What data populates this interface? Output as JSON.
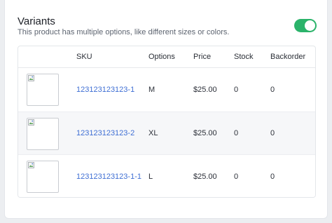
{
  "header": {
    "title": "Variants",
    "subtitle": "This product has multiple options, like different sizes or colors.",
    "toggle_on": true,
    "toggle_color": "#2bb36a"
  },
  "table": {
    "columns": [
      "",
      "SKU",
      "Options",
      "Price",
      "Stock",
      "Backorder"
    ],
    "rows": [
      {
        "sku": "123123123123-1",
        "option": "M",
        "price": "$25.00",
        "stock": "0",
        "backorder": "0"
      },
      {
        "sku": "123123123123-2",
        "option": "XL",
        "price": "$25.00",
        "stock": "0",
        "backorder": "0"
      },
      {
        "sku": "123123123123-1-1",
        "option": "L",
        "price": "$25.00",
        "stock": "0",
        "backorder": "0"
      }
    ]
  },
  "colors": {
    "link": "#3f6fd4",
    "alt_row": "#f6f7f9"
  },
  "icons": {
    "thumbnail": "broken-image-icon"
  }
}
